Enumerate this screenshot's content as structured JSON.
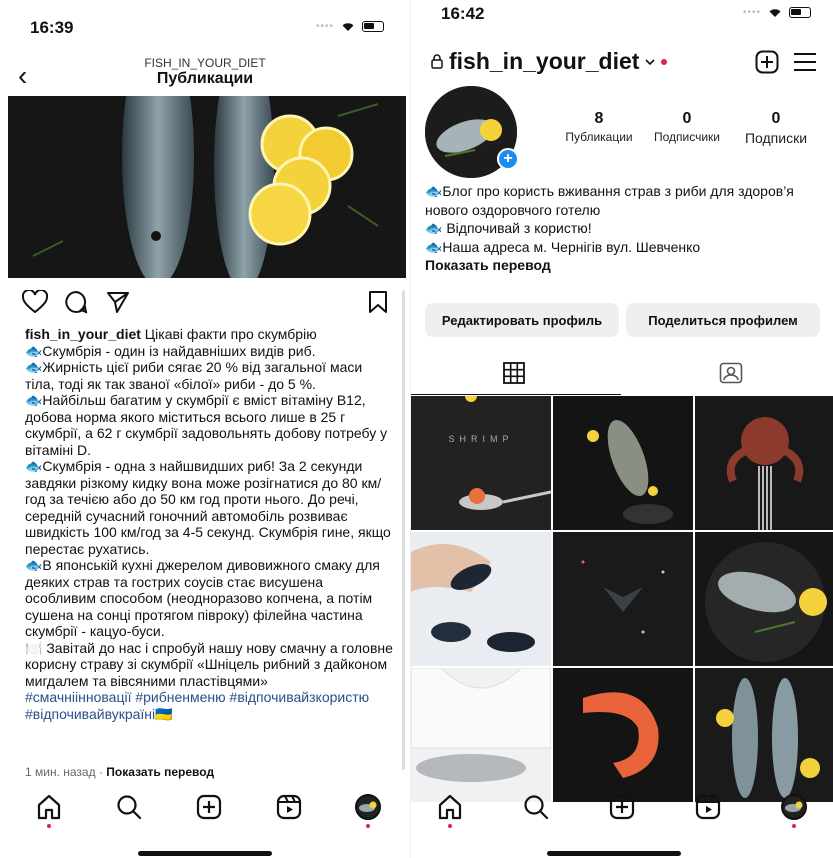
{
  "left": {
    "status_time": "16:39",
    "header_username": "FISH_IN_YOUR_DIET",
    "header_title": "Публикации",
    "caption_user": "fish_in_your_diet",
    "caption_lines": [
      " Цікаві факти про скумбрію",
      "🐟Скумбрія - один із найдавніших видів риб.",
      "🐟Жирність цієї риби сягає 20 % від загальної маси тіла, тоді як так званої «білої» риби - до 5 %.",
      "🐟Найбільш багатим у скумбрії є вміст вітаміну B12, добова норма якого міститься всього лише в 25 г скумбрії, а 62 г скумбрії задовольнять добову потребу у вітаміні D.",
      "🐟Скумбрія - одна з найшвидших риб! За 2 секунди завдяки різкому кидку вона може розігнатися до 80 км/год за течією або до 50 км год проти нього. До речі, середній сучасний гоночний автомобіль розвиває швидкість 100 км/год за 4-5 секунд. Скумбрія гине, якщо перестає рухатись.",
      "🐟В японській кухні джерелом дивовижного смаку для деяких страв та гострих соусів стає висушена особливим способом (неодноразово копчена, а потім сушена на сонці протягом півроку) філейна частина скумбрії - кацуо-буси.",
      "🍽️ Завітай до нас і спробуй нашу нову смачну а головне корисну страву зі скумбрії «Шніцель рибний з дайконом мигдалем та вівсяними пластівцями»"
    ],
    "hashtags": "#смачніінновації #рибненменю #відпочивайзкористю #відпочивайвукраїні🇺🇦",
    "time_ago": "1 мин. назад",
    "separator": " · ",
    "show_translation": "Показать перевод"
  },
  "right": {
    "status_time": "16:42",
    "username": "fish_in_your_diet",
    "stats": [
      {
        "num": "8",
        "label": "Публикации"
      },
      {
        "num": "0",
        "label": "Подписчики"
      },
      {
        "num": "0",
        "label": "Подписки"
      }
    ],
    "bio_lines": [
      "🐟Блог про користь вживання страв з риби для здоров’я нового оздоровчого готелю",
      "🐟 Відпочивай з користю!",
      "🐟Наша адреса м. Чернігів вул. Шевченко"
    ],
    "show_translation": "Показать перевод",
    "edit_profile": "Редактировать профиль",
    "share_profile": "Поделиться профилем",
    "grid_text": "SHRIMP"
  },
  "colors": {
    "accent_blue": "#1d8cf0",
    "notification_red": "#e1214a",
    "hashtag": "#2b4f8a",
    "button_bg": "#efefef"
  },
  "icons": {
    "tabbar": [
      "home-icon",
      "search-icon",
      "create-icon",
      "reels-icon",
      "profile-avatar"
    ],
    "post_actions": [
      "heart-icon",
      "comment-icon",
      "share-icon",
      "bookmark-icon"
    ]
  }
}
